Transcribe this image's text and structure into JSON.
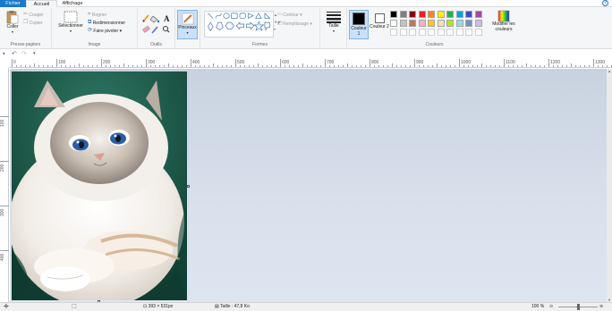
{
  "tabs": {
    "file": "Fichier",
    "home": "Accueil",
    "view": "Affichage"
  },
  "help_glyph": "?",
  "clipboard": {
    "paste": "Coller",
    "cut": "Couper",
    "copy": "Copier",
    "group": "Presse-papiers"
  },
  "image": {
    "select": "Sélectionner",
    "crop": "Rogner",
    "resize": "Redimensionner",
    "rotate": "Faire pivoter",
    "group": "Image"
  },
  "tools": {
    "group": "Outils",
    "text_glyph": "A"
  },
  "brushes": {
    "label": "Pinceaux"
  },
  "shapes": {
    "group": "Formes",
    "outline": "Contour",
    "fill": "Remplissage"
  },
  "size": {
    "label": "Taille"
  },
  "colors": {
    "color1": "Couleur 1",
    "color2": "Couleur 2",
    "edit": "Modifier les couleurs",
    "group": "Couleurs",
    "color1_value": "#000000",
    "color2_value": "#ffffff",
    "palette_row1": [
      "#000000",
      "#7f7f7f",
      "#880015",
      "#ed1c24",
      "#ff7f27",
      "#fff200",
      "#22b14c",
      "#00a2e8",
      "#3f48cc",
      "#a349a4"
    ],
    "palette_row2": [
      "#ffffff",
      "#c3c3c3",
      "#b97a57",
      "#ffaec9",
      "#ffc90e",
      "#efe4b0",
      "#b5e61d",
      "#99d9ea",
      "#7092be",
      "#c8bfe7"
    ]
  },
  "ruler_h": [
    "0",
    "100",
    "200",
    "300",
    "400",
    "500",
    "600",
    "700",
    "800",
    "900",
    "1000",
    "1100",
    "1200",
    "1300"
  ],
  "ruler_v": [
    "100",
    "200",
    "300",
    "400"
  ],
  "status": {
    "dimensions": "393 × 531px",
    "filesize": "Taille : 47,8 Ko",
    "zoom": "100 %"
  }
}
